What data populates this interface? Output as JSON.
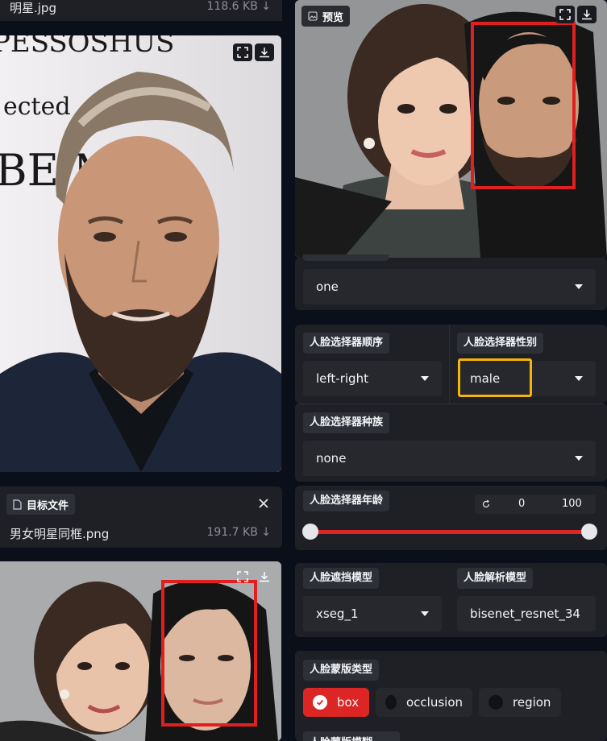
{
  "source_file": {
    "name": "明星.jpg",
    "size": "118.6 KB ↓"
  },
  "target_section": {
    "label": "目标文件",
    "file_name": "男女明星同框.png",
    "file_size": "191.7 KB ↓"
  },
  "preview": {
    "label": "预览"
  },
  "source_image_text": {
    "line1": "PESSOSHUS",
    "line2": "ected",
    "line3": "BE M"
  },
  "partial_select": {
    "value": "one"
  },
  "face_selector_order": {
    "label": "人脸选择器顺序",
    "value": "left-right"
  },
  "face_selector_gender": {
    "label": "人脸选择器性别",
    "value": "male"
  },
  "face_selector_race": {
    "label": "人脸选择器种族",
    "value": "none"
  },
  "face_selector_age": {
    "label": "人脸选择器年龄",
    "min": "0",
    "max": "100",
    "range": [
      0,
      100
    ]
  },
  "face_occluder_model": {
    "label": "人脸遮挡模型",
    "value": "xseg_1"
  },
  "face_parser_model": {
    "label": "人脸解析模型",
    "value": "bisenet_resnet_34"
  },
  "face_mask_types": {
    "label": "人脸蒙版类型",
    "options": [
      {
        "label": "box",
        "checked": true
      },
      {
        "label": "occlusion",
        "checked": false
      },
      {
        "label": "region",
        "checked": false
      }
    ]
  },
  "bottom_cut_label": {
    "label": "人脸蒙版模糊"
  },
  "colors": {
    "accent": "#dc2626",
    "highlight": "#f5b40a",
    "detect_box": "#e02020",
    "panel": "#1f2025"
  }
}
